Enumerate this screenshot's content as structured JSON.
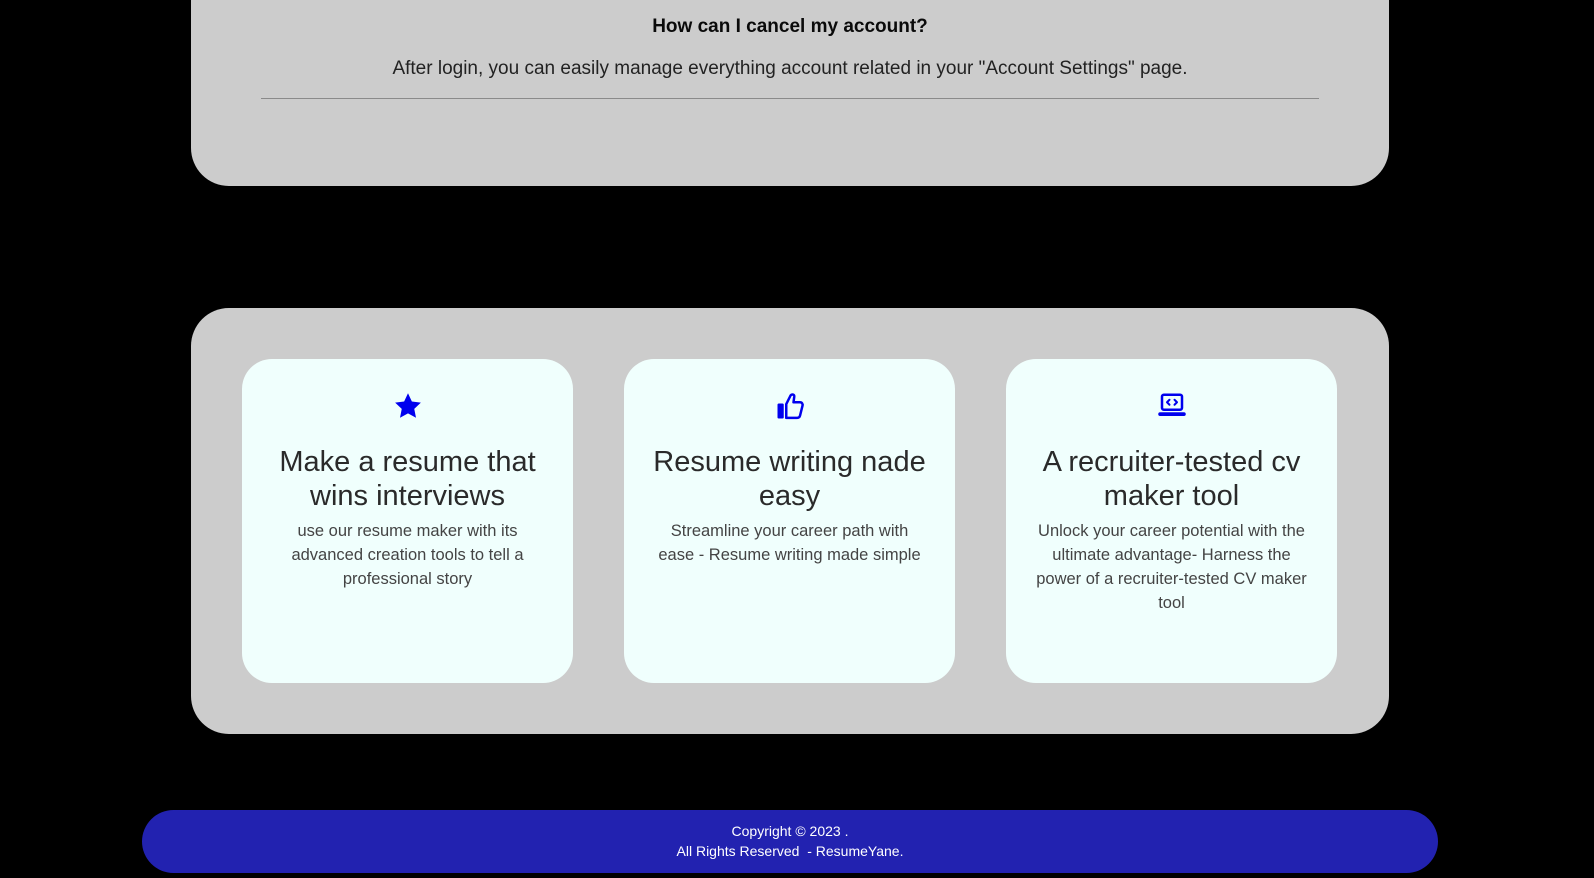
{
  "faq": {
    "question": "How can I cancel my account?",
    "answer": "After login, you can easily manage everything account related in your \"Account Settings\" page."
  },
  "features": [
    {
      "icon": "star-icon",
      "title": "Make a resume that wins interviews",
      "text": "use our resume maker with its advanced creation tools to tell a professional story"
    },
    {
      "icon": "thumbs-up-icon",
      "title": "Resume writing nade easy",
      "text": "Streamline your career path with ease - Resume writing made simple"
    },
    {
      "icon": "laptop-code-icon",
      "title": "A recruiter-tested cv maker tool",
      "text": "Unlock your career potential with the ultimate advantage- Harness the power of a recruiter-tested CV maker tool"
    }
  ],
  "footer": {
    "copyright": "Copyright © 2023 .",
    "rights": "All Rights Reserved  - ResumeYane."
  },
  "colors": {
    "background": "#000000",
    "panel": "#cccccc",
    "card": "#f0fffd",
    "icon": "#0000ee",
    "footer": "#2222b0"
  }
}
